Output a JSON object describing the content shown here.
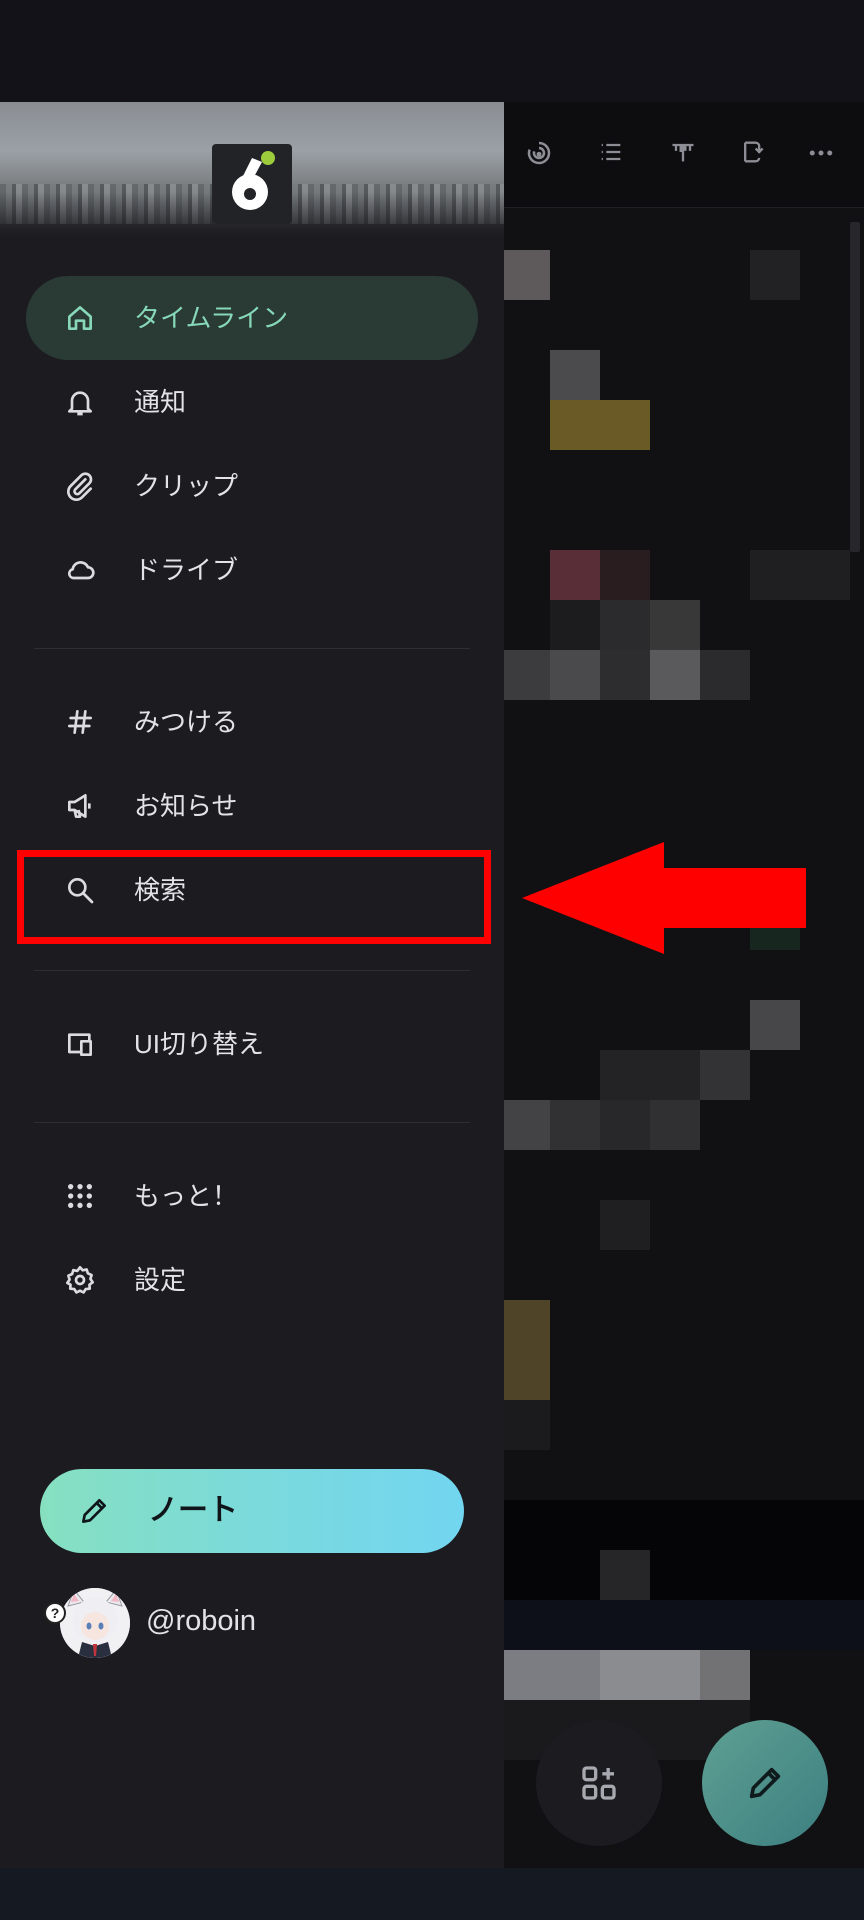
{
  "drawer": {
    "nav_items": [
      {
        "label": "タイムライン",
        "icon": "home-icon",
        "active": true
      },
      {
        "label": "通知",
        "icon": "bell-icon"
      },
      {
        "label": "クリップ",
        "icon": "paperclip-icon"
      },
      {
        "label": "ドライブ",
        "icon": "cloud-icon"
      },
      {
        "label": "みつける",
        "icon": "hashtag-icon"
      },
      {
        "label": "お知らせ",
        "icon": "megaphone-icon"
      },
      {
        "label": "検索",
        "icon": "search-icon",
        "highlighted": true
      },
      {
        "label": "UI切り替え",
        "icon": "devices-icon"
      },
      {
        "label": "もっと！",
        "icon": "grid-dots-icon"
      },
      {
        "label": "設定",
        "icon": "gear-icon"
      }
    ],
    "note_button": {
      "label": "ノート",
      "icon": "pencil-icon"
    },
    "account": {
      "username": "@roboin",
      "badge": "?"
    }
  },
  "timeline_header_icons": [
    "swirl-icon",
    "list-icon",
    "antenna-icon",
    "share-icon",
    "more-icon"
  ],
  "colors": {
    "accent": "#86d8b9",
    "active_bg": "#2a3a35",
    "drawer_bg": "#1b1b20",
    "highlight": "#ff0000",
    "note_gradient_start": "#86e0c0",
    "note_gradient_end": "#72d6f0"
  }
}
